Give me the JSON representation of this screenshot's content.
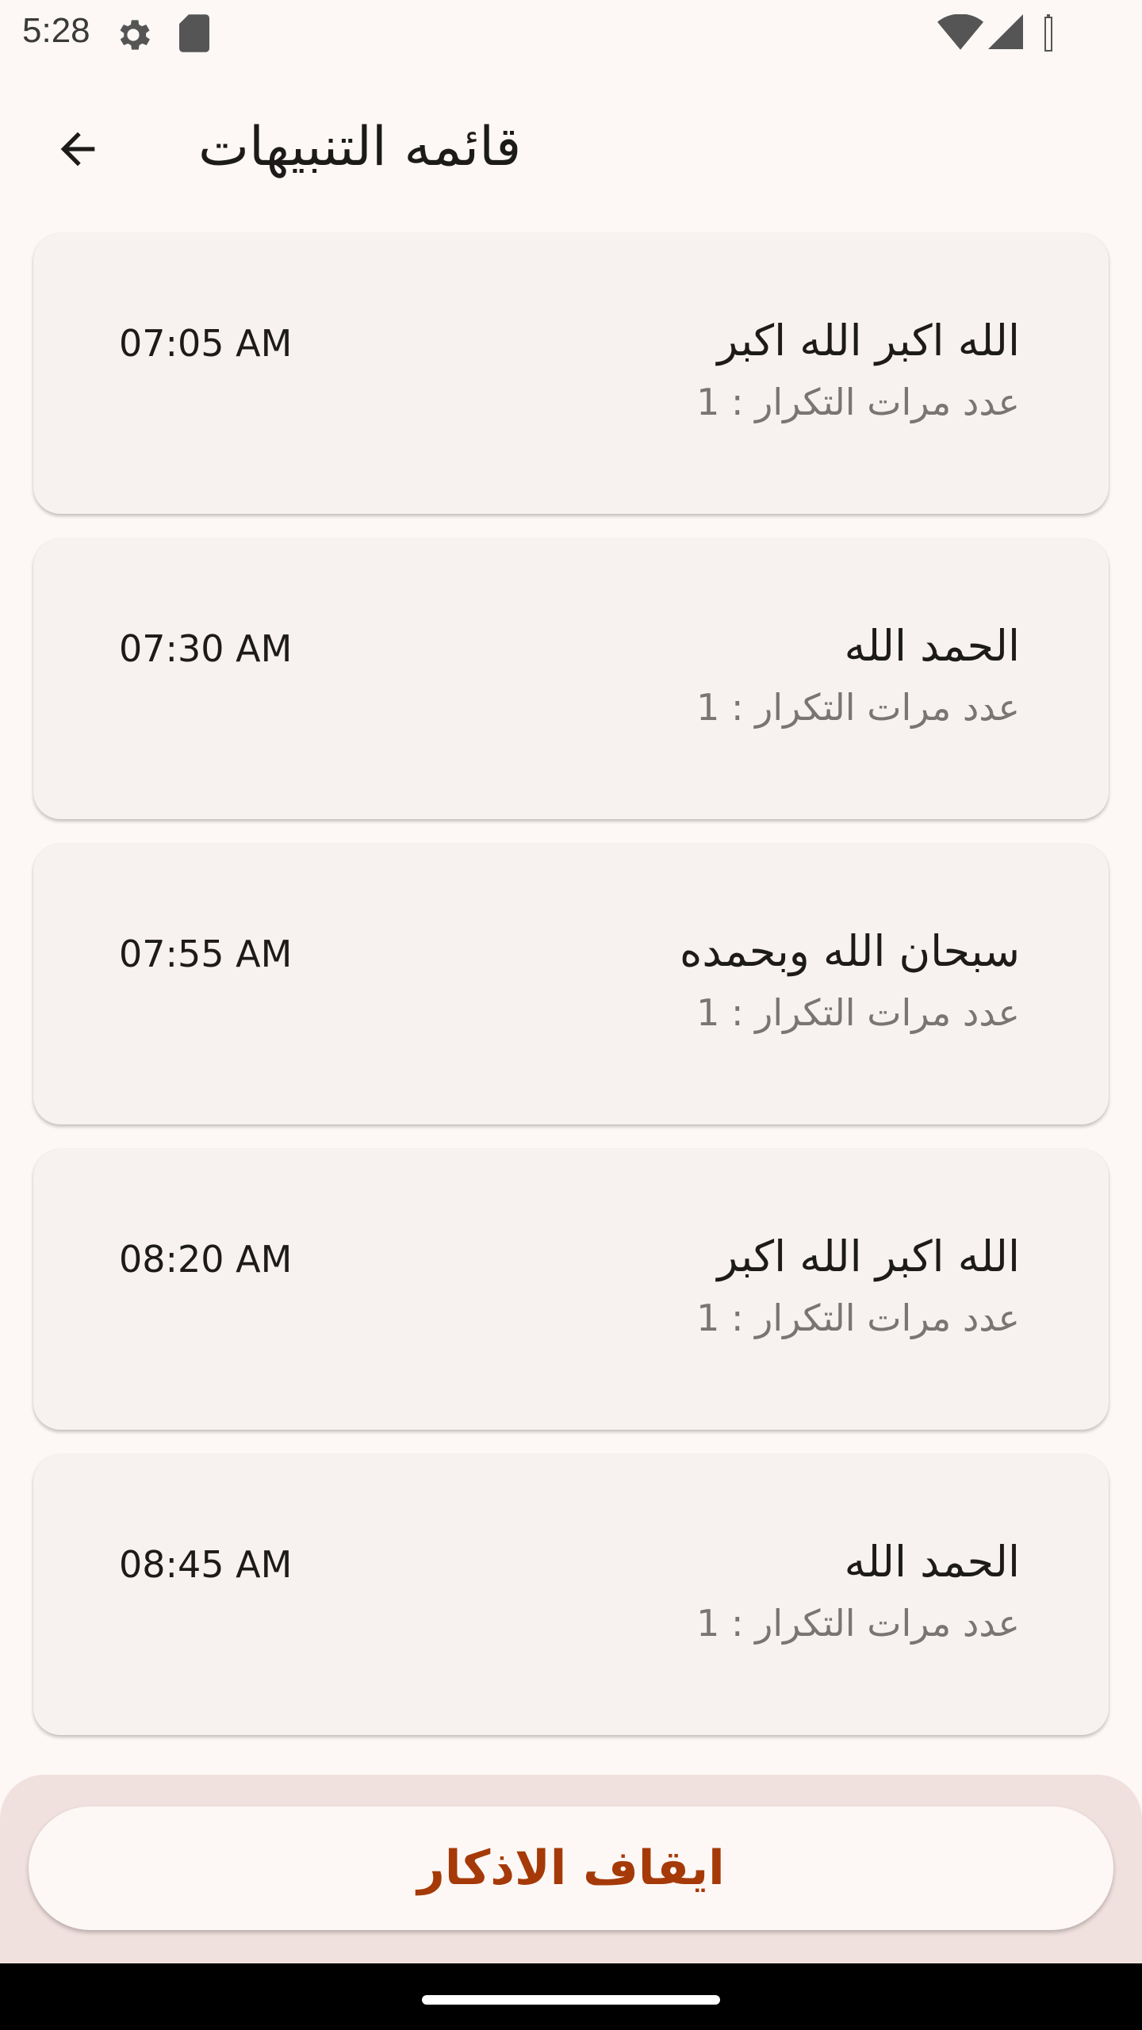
{
  "status_bar": {
    "time": "5:28",
    "icons": [
      "settings-gear-icon",
      "sd-card-icon",
      "wifi-icon",
      "cell-signal-icon",
      "battery-icon"
    ]
  },
  "app_bar": {
    "back_icon": "arrow-back-icon",
    "title": "قائمه التنبيهات"
  },
  "alerts": [
    {
      "title": "الله اكبر الله اكبر",
      "count": "عدد مرات التكرار : 1",
      "time": "07:05 AM"
    },
    {
      "title": "الحمد الله",
      "count": "عدد مرات التكرار : 1",
      "time": "07:30 AM"
    },
    {
      "title": "سبحان الله وبحمده",
      "count": "عدد مرات التكرار : 1",
      "time": "07:55 AM"
    },
    {
      "title": "الله اكبر الله اكبر",
      "count": "عدد مرات التكرار : 1",
      "time": "08:20 AM"
    },
    {
      "title": "الحمد الله",
      "count": "عدد مرات التكرار : 1",
      "time": "08:45 AM"
    }
  ],
  "stop_button": {
    "label": "ايقاف الاذكار"
  },
  "colors": {
    "background": "#fdf8f6",
    "card": "#f7f1ef",
    "accent_text": "#a53a08",
    "bottom_panel": "#f1e1de"
  }
}
